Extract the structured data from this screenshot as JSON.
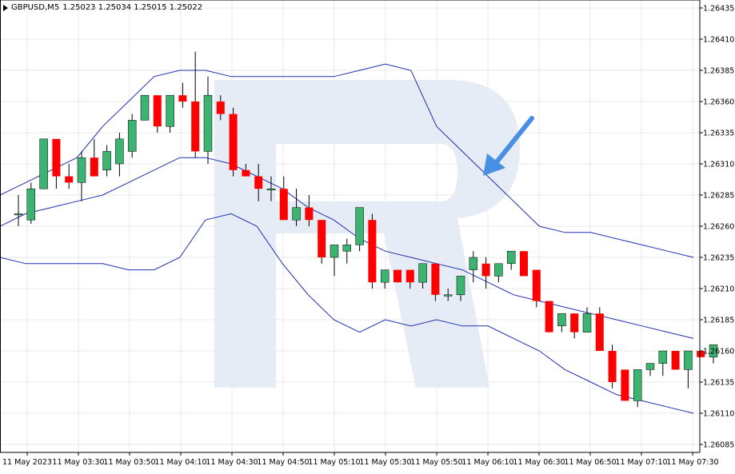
{
  "header": {
    "symbol": "GBPUSD,M5",
    "ohlc": "1.25023 1.25034 1.25015 1.25022"
  },
  "colors": {
    "bull": "#3cb371",
    "bear": "#ff0000",
    "band": "#1f2fb0",
    "grid": "#e8e8e8",
    "arrow": "#4a90e2",
    "watermark": "#e6ecf5"
  },
  "chart_data": {
    "type": "candlestick",
    "y_ticks": [
      "1.26435",
      "1.26410",
      "1.26385",
      "1.26360",
      "1.26335",
      "1.26310",
      "1.26285",
      "1.26260",
      "1.26235",
      "1.26210",
      "1.26185",
      "1.26160",
      "1.26135",
      "1.26110",
      "1.26085"
    ],
    "ylim": [
      1.26085,
      1.26435
    ],
    "x_labels": [
      "11 May 2023",
      "11 May 03:30",
      "11 May 03:50",
      "11 May 04:10",
      "11 May 04:30",
      "11 May 04:50",
      "11 May 05:10",
      "11 May 05:30",
      "11 May 05:50",
      "11 May 06:10",
      "11 May 06:30",
      "11 May 06:50",
      "11 May 07:10",
      "11 May 07:30"
    ],
    "candles": [
      {
        "o": 1.2627,
        "h": 1.26285,
        "l": 1.2626,
        "c": 1.2627
      },
      {
        "o": 1.26265,
        "h": 1.26295,
        "l": 1.26262,
        "c": 1.2629
      },
      {
        "o": 1.2629,
        "h": 1.2633,
        "l": 1.2629,
        "c": 1.2633
      },
      {
        "o": 1.2633,
        "h": 1.2633,
        "l": 1.2629,
        "c": 1.263
      },
      {
        "o": 1.263,
        "h": 1.2631,
        "l": 1.2629,
        "c": 1.26295
      },
      {
        "o": 1.26295,
        "h": 1.2632,
        "l": 1.2628,
        "c": 1.26315
      },
      {
        "o": 1.26315,
        "h": 1.2633,
        "l": 1.263,
        "c": 1.263
      },
      {
        "o": 1.26305,
        "h": 1.26325,
        "l": 1.263,
        "c": 1.2632
      },
      {
        "o": 1.2631,
        "h": 1.26335,
        "l": 1.263,
        "c": 1.2633
      },
      {
        "o": 1.2632,
        "h": 1.2635,
        "l": 1.26315,
        "c": 1.26345
      },
      {
        "o": 1.26345,
        "h": 1.26365,
        "l": 1.26345,
        "c": 1.26365
      },
      {
        "o": 1.26365,
        "h": 1.26365,
        "l": 1.26335,
        "c": 1.2634
      },
      {
        "o": 1.2634,
        "h": 1.26365,
        "l": 1.26335,
        "c": 1.26365
      },
      {
        "o": 1.26365,
        "h": 1.26375,
        "l": 1.26355,
        "c": 1.2636
      },
      {
        "o": 1.2636,
        "h": 1.264,
        "l": 1.26315,
        "c": 1.2632
      },
      {
        "o": 1.2632,
        "h": 1.2638,
        "l": 1.2631,
        "c": 1.26365
      },
      {
        "o": 1.2636,
        "h": 1.26365,
        "l": 1.26345,
        "c": 1.2635
      },
      {
        "o": 1.2635,
        "h": 1.26355,
        "l": 1.263,
        "c": 1.26305
      },
      {
        "o": 1.26305,
        "h": 1.2631,
        "l": 1.263,
        "c": 1.263
      },
      {
        "o": 1.263,
        "h": 1.2631,
        "l": 1.2628,
        "c": 1.2629
      },
      {
        "o": 1.2629,
        "h": 1.263,
        "l": 1.2628,
        "c": 1.2629
      },
      {
        "o": 1.2629,
        "h": 1.263,
        "l": 1.26265,
        "c": 1.26265
      },
      {
        "o": 1.26265,
        "h": 1.2629,
        "l": 1.2626,
        "c": 1.26275
      },
      {
        "o": 1.26275,
        "h": 1.26285,
        "l": 1.2626,
        "c": 1.26265
      },
      {
        "o": 1.26265,
        "h": 1.26265,
        "l": 1.2623,
        "c": 1.26235
      },
      {
        "o": 1.26235,
        "h": 1.26245,
        "l": 1.2622,
        "c": 1.26245
      },
      {
        "o": 1.2624,
        "h": 1.2625,
        "l": 1.2623,
        "c": 1.26245
      },
      {
        "o": 1.26245,
        "h": 1.26275,
        "l": 1.2624,
        "c": 1.26275
      },
      {
        "o": 1.26265,
        "h": 1.2627,
        "l": 1.2621,
        "c": 1.26215
      },
      {
        "o": 1.26215,
        "h": 1.26225,
        "l": 1.2621,
        "c": 1.26225
      },
      {
        "o": 1.26225,
        "h": 1.26225,
        "l": 1.26215,
        "c": 1.26215
      },
      {
        "o": 1.26225,
        "h": 1.26225,
        "l": 1.2621,
        "c": 1.26215
      },
      {
        "o": 1.26215,
        "h": 1.2623,
        "l": 1.2621,
        "c": 1.2623
      },
      {
        "o": 1.2623,
        "h": 1.2623,
        "l": 1.262,
        "c": 1.26205
      },
      {
        "o": 1.26205,
        "h": 1.2621,
        "l": 1.262,
        "c": 1.26205
      },
      {
        "o": 1.26205,
        "h": 1.2622,
        "l": 1.262,
        "c": 1.2622
      },
      {
        "o": 1.26225,
        "h": 1.2624,
        "l": 1.26215,
        "c": 1.26235
      },
      {
        "o": 1.2623,
        "h": 1.26235,
        "l": 1.2621,
        "c": 1.2622
      },
      {
        "o": 1.2622,
        "h": 1.2623,
        "l": 1.26215,
        "c": 1.2623
      },
      {
        "o": 1.2623,
        "h": 1.2624,
        "l": 1.26225,
        "c": 1.2624
      },
      {
        "o": 1.2624,
        "h": 1.2624,
        "l": 1.2622,
        "c": 1.2622
      },
      {
        "o": 1.26225,
        "h": 1.26225,
        "l": 1.26195,
        "c": 1.262
      },
      {
        "o": 1.262,
        "h": 1.262,
        "l": 1.26175,
        "c": 1.26175
      },
      {
        "o": 1.2618,
        "h": 1.2619,
        "l": 1.26175,
        "c": 1.2619
      },
      {
        "o": 1.2619,
        "h": 1.2619,
        "l": 1.2617,
        "c": 1.26175
      },
      {
        "o": 1.26175,
        "h": 1.26195,
        "l": 1.26175,
        "c": 1.2619
      },
      {
        "o": 1.2619,
        "h": 1.26195,
        "l": 1.2616,
        "c": 1.2616
      },
      {
        "o": 1.2616,
        "h": 1.26165,
        "l": 1.2613,
        "c": 1.26135
      },
      {
        "o": 1.26145,
        "h": 1.26145,
        "l": 1.2612,
        "c": 1.2612
      },
      {
        "o": 1.2612,
        "h": 1.26145,
        "l": 1.26115,
        "c": 1.26145
      },
      {
        "o": 1.26145,
        "h": 1.2615,
        "l": 1.2614,
        "c": 1.2615
      },
      {
        "o": 1.2615,
        "h": 1.2616,
        "l": 1.2614,
        "c": 1.2616
      },
      {
        "o": 1.2616,
        "h": 1.2616,
        "l": 1.26145,
        "c": 1.26145
      },
      {
        "o": 1.26145,
        "h": 1.2616,
        "l": 1.2613,
        "c": 1.2616
      },
      {
        "o": 1.2616,
        "h": 1.2616,
        "l": 1.26155,
        "c": 1.26155
      },
      {
        "o": 1.26155,
        "h": 1.26165,
        "l": 1.2615,
        "c": 1.26165
      }
    ],
    "bands": {
      "upper": [
        1.26285,
        1.26295,
        1.26305,
        1.26315,
        1.2634,
        1.2636,
        1.2638,
        1.26385,
        1.26385,
        1.2638,
        1.2638,
        1.2638,
        1.2638,
        1.2638,
        1.26385,
        1.2639,
        1.26385,
        1.2634,
        1.2632,
        1.263,
        1.2628,
        1.2626,
        1.26255,
        1.26255,
        1.2625,
        1.26245,
        1.2624,
        1.26235
      ],
      "middle": [
        1.2626,
        1.2627,
        1.26275,
        1.2628,
        1.26285,
        1.26295,
        1.26305,
        1.26315,
        1.26315,
        1.2631,
        1.263,
        1.2629,
        1.26275,
        1.26265,
        1.2625,
        1.2624,
        1.26235,
        1.2623,
        1.26225,
        1.26215,
        1.26205,
        1.262,
        1.26195,
        1.2619,
        1.26185,
        1.2618,
        1.26175,
        1.2617
      ],
      "lower": [
        1.26235,
        1.2623,
        1.2623,
        1.2623,
        1.2623,
        1.26225,
        1.26225,
        1.26235,
        1.26265,
        1.2627,
        1.2626,
        1.2623,
        1.26205,
        1.26185,
        1.26175,
        1.26185,
        1.2618,
        1.26185,
        1.2618,
        1.2618,
        1.2617,
        1.2616,
        1.26145,
        1.26135,
        1.26125,
        1.2612,
        1.26115,
        1.2611
      ]
    }
  }
}
